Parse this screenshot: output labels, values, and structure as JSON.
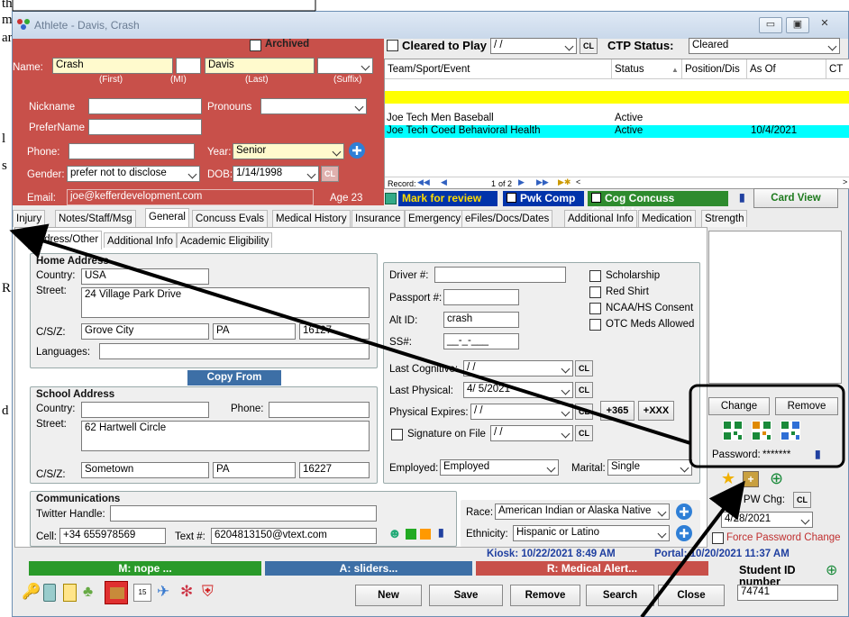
{
  "background_doc": {
    "letters": [
      "th",
      "m",
      "ar",
      "l",
      "s",
      "R",
      "d"
    ]
  },
  "window": {
    "title": "Athlete - Davis, Crash"
  },
  "header": {
    "archived_label": "Archived",
    "name_label": "Name:",
    "first_name": "Crash",
    "last_name": "Davis",
    "hint_first": "(First)",
    "hint_mi": "(MI)",
    "hint_last": "(Last)",
    "hint_suffix": "(Suffix)",
    "nickname_label": "Nickname",
    "pronouns_label": "Pronouns",
    "prefername_label": "PreferName",
    "phone_label": "Phone:",
    "year_label": "Year:",
    "year_value": "Senior",
    "gender_label": "Gender:",
    "gender_value": "prefer not to disclose",
    "dob_label": "DOB:",
    "dob_value": "1/14/1998",
    "cl": "CL",
    "email_label": "Email:",
    "email_value": "joe@kefferdevelopment.com",
    "age": "Age 23"
  },
  "clearance": {
    "cleared_label": "Cleared to Play",
    "cleared_date": "/ /",
    "cl": "CL",
    "ctp_label": "CTP Status:",
    "ctp_value": "Cleared"
  },
  "grid": {
    "headers": [
      "Team/Sport/Event",
      "Status",
      "Position/Dis",
      "As Of",
      "CT"
    ],
    "rows": [
      {
        "team": "",
        "status": "",
        "position": "",
        "asof": "",
        "color": "#ffff00"
      },
      {
        "team": "Joe Tech Men Baseball",
        "status": "Active",
        "position": "",
        "asof": "",
        "color": "#ffffff"
      },
      {
        "team": "Joe Tech Coed Behavioral Health",
        "status": "Active",
        "position": "",
        "asof": "10/4/2021",
        "color": "#00ffff"
      }
    ],
    "record_label": "Record:",
    "record_pos": "1",
    "record_of": "of 2"
  },
  "flags": {
    "review": "Mark for review",
    "pwk": "Pwk Comp",
    "cog": "Cog Concuss Complete",
    "card_view": "Card View"
  },
  "tabs": [
    "Injury",
    "Notes/Staff/Msg",
    "General",
    "Concuss Evals",
    "Medical History",
    "Insurance",
    "Emergency",
    "eFiles/Docs/Dates",
    "Additional Info",
    "Medication",
    "Strength"
  ],
  "subtabs": [
    "Address/Other",
    "Additional Info",
    "Academic Eligibility"
  ],
  "home": {
    "title": "Home Address",
    "country_label": "Country:",
    "country": "USA",
    "street_label": "Street:",
    "street": "24 Village Park Drive",
    "csz_label": "C/S/Z:",
    "city": "Grove City",
    "state": "PA",
    "zip": "16127",
    "languages_label": "Languages:"
  },
  "copy_from": "Copy From",
  "school": {
    "title": "School Address",
    "country_label": "Country:",
    "phone_label": "Phone:",
    "street_label": "Street:",
    "street": "62 Hartwell Circle",
    "csz_label": "C/S/Z:",
    "city": "Sometown",
    "state": "PA",
    "zip": "16227"
  },
  "ids": {
    "driver_label": "Driver #:",
    "passport_label": "Passport #:",
    "alt_label": "Alt ID:",
    "alt_value": "crash",
    "ssn_label": "SS#:",
    "ssn_value": "__-_-___",
    "last_cog_label": "Last Cognitive:",
    "last_cog_value": "/ /",
    "last_phys_label": "Last Physical:",
    "last_phys_value": "4/ 5/2021",
    "phys_exp_label": "Physical Expires:",
    "phys_exp_value": "/ /",
    "sig_label": "Signature on File",
    "sig_value": "/ /",
    "employed_label": "Employed:",
    "employed_value": "Employed",
    "marital_label": "Marital:",
    "marital_value": "Single",
    "plus365": "+365",
    "plusxxx": "+XXX",
    "cl": "CL"
  },
  "checks": [
    "Scholarship",
    "Red Shirt",
    "NCAA/HS Consent",
    "OTC Meds Allowed"
  ],
  "photo": {
    "change": "Change",
    "remove": "Remove",
    "password_label": "Password:",
    "password_value": "*******"
  },
  "pw": {
    "label": "Last PW Chg:",
    "cl": "CL",
    "value": "4/28/2021",
    "force": "Force Password Change"
  },
  "comms": {
    "title": "Communications",
    "twitter_label": "Twitter Handle:",
    "cell_label": "Cell:",
    "cell": "+34 655978569",
    "text_label": "Text #:",
    "text_value": "6204813150@vtext.com"
  },
  "demo": {
    "race_label": "Race:",
    "race_value": "American Indian or Alaska Native",
    "eth_label": "Ethnicity:",
    "eth_value": "Hispanic or Latino"
  },
  "kiosk": {
    "kiosk": "Kiosk: 10/22/2021 8:49 AM",
    "portal": "Portal: 10/20/2021 11:37 AM"
  },
  "alerts": {
    "m": "M: nope ...",
    "a": "A: sliders...",
    "r": "R: Medical Alert..."
  },
  "student": {
    "label": "Student ID number",
    "value": "74741"
  },
  "buttons": {
    "new": "New",
    "save": "Save",
    "remove": "Remove",
    "search": "Search",
    "close": "Close"
  },
  "colors": {
    "red_panel": "#c8504a",
    "teal_row": "#00ffff",
    "yellow_row": "#ffff00",
    "card_green": "#2e8b2e"
  }
}
